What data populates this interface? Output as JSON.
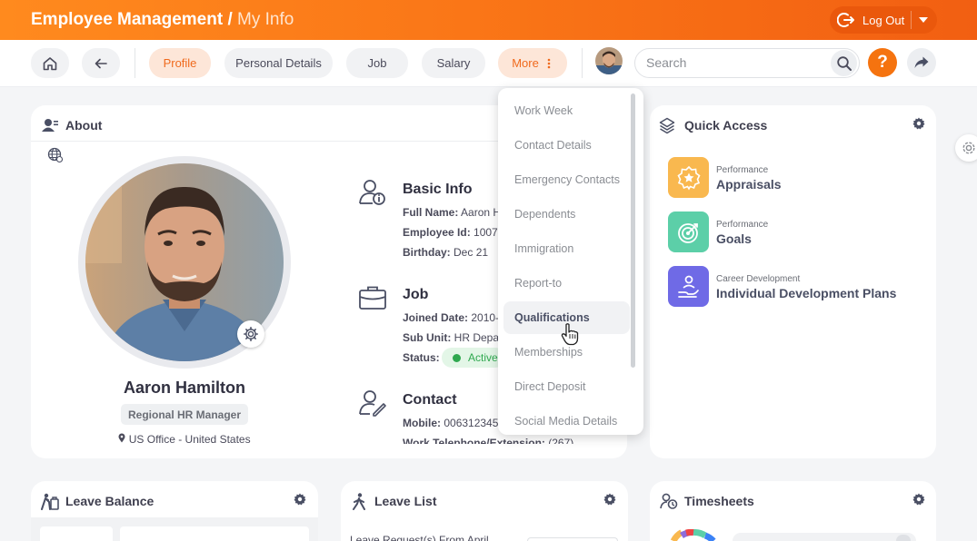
{
  "header": {
    "title": "Employee Management",
    "separator": " / ",
    "subtitle": "My Info",
    "logout_label": "Log Out"
  },
  "nav": {
    "tabs": [
      {
        "label": "Profile",
        "active": true
      },
      {
        "label": "Personal Details",
        "active": false
      },
      {
        "label": "Job",
        "active": false
      },
      {
        "label": "Salary",
        "active": false
      },
      {
        "label": "More",
        "active": false
      }
    ],
    "search_placeholder": "Search",
    "help_label": "?"
  },
  "about": {
    "title": "About",
    "name": "Aaron Hamilton",
    "role": "Regional HR Manager",
    "location": "US Office - United States",
    "basic_info": {
      "title": "Basic Info",
      "full_name_label": "Full Name:",
      "full_name_value": "Aaron H",
      "employee_id_label": "Employee Id:",
      "employee_id_value": "1007",
      "birthday_label": "Birthday:",
      "birthday_value": "Dec 21"
    },
    "job": {
      "title": "Job",
      "joined_label": "Joined Date:",
      "joined_value": "2010-",
      "sub_unit_label": "Sub Unit:",
      "sub_unit_value": "HR Depa",
      "status_label": "Status:",
      "status_value": "Active"
    },
    "contact": {
      "title": "Contact",
      "mobile_label": "Mobile:",
      "mobile_value": "006312345",
      "work_tel_label": "Work Telephone/Extension:",
      "work_tel_value": "(267)"
    }
  },
  "more_menu": {
    "items": [
      "Work Week",
      "Contact Details",
      "Emergency Contacts",
      "Dependents",
      "Immigration",
      "Report-to",
      "Qualifications",
      "Memberships",
      "Direct Deposit",
      "Social Media Details"
    ],
    "hovered_index": 6
  },
  "quick_access": {
    "title": "Quick Access",
    "items": [
      {
        "category": "Performance",
        "label": "Appraisals",
        "color": "#f9b84f",
        "icon": "star-badge-icon"
      },
      {
        "category": "Performance",
        "label": "Goals",
        "color": "#5ccfa8",
        "icon": "target-icon"
      },
      {
        "category": "Career Development",
        "label": "Individual Development Plans",
        "color": "#6f6ae6",
        "icon": "growth-hand-icon"
      }
    ]
  },
  "widgets": {
    "leave_balance_title": "Leave Balance",
    "leave_list_title": "Leave List",
    "leave_list_preview": "Leave Request(s) From April",
    "timesheets_title": "Timesheets"
  },
  "colors": {
    "brand_orange": "#f97316",
    "active_tab_bg": "#fde6d8",
    "status_green": "#2fa84f"
  }
}
